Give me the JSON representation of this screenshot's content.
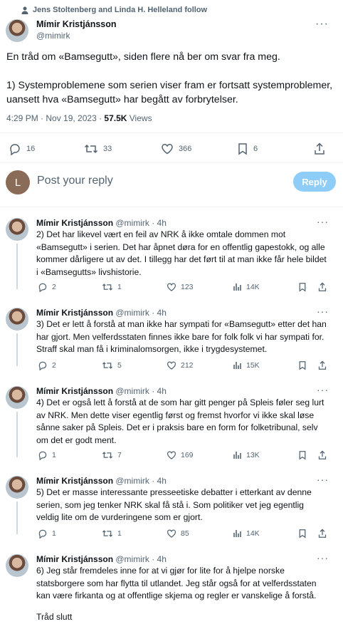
{
  "social_context": "Jens Stoltenberg and Linda H. Helleland follow",
  "main_tweet": {
    "author_name": "Mímir Kristjánsson",
    "author_handle": "@mimirk",
    "text": "En tråd om «Bamsegutt», siden flere nå ber om svar fra meg.\n\n1) Systemproblemene som serien viser fram er fortsatt systemproblemer, uansett hva «Bamsegutt» har begått av forbrytelser.",
    "timestamp": "4:29 PM · Nov 19, 2023 · ",
    "views_count": "57.5K",
    "views_label": " Views",
    "replies": "16",
    "retweets": "33",
    "likes": "366",
    "bookmarks": "6"
  },
  "reply_box": {
    "avatar_letter": "L",
    "placeholder": "Post your reply",
    "button_label": "Reply"
  },
  "thread": [
    {
      "name": "Mímir Kristjánsson",
      "handle": "@mimirk",
      "time": " · 4h",
      "text": "2) Det har likevel vært en feil av NRK å ikke omtale dommen mot «Bamsegutt» i serien. Det har åpnet døra for en offentlig gapestokk, og alle kommer dårligere ut av det. I tillegg har det ført til at man ikke får hele bildet i «Bamsegutts» livshistorie.",
      "replies": "2",
      "retweets": "1",
      "likes": "123",
      "views": "14K"
    },
    {
      "name": "Mímir Kristjánsson",
      "handle": "@mimirk",
      "time": " · 4h",
      "text": "3) Det er lett å forstå at man ikke har sympati for «Bamsegutt» etter det han har gjort. Men velferdsstaten finnes ikke bare for folk folk vi har sympati for. Straff skal man få i kriminalomsorgen, ikke i trygdesystemet.",
      "replies": "2",
      "retweets": "5",
      "likes": "212",
      "views": "15K"
    },
    {
      "name": "Mímir Kristjánsson",
      "handle": "@mimirk",
      "time": " · 4h",
      "text": "4) Det er også lett å forstå at de som har gitt penger på Spleis føler seg lurt av NRK. Men dette viser egentlig først og fremst hvorfor vi ikke skal løse sånne saker på Spleis. Det er i praksis bare en form for folketribunal, selv om det er godt ment.",
      "replies": "1",
      "retweets": "7",
      "likes": "169",
      "views": "13K"
    },
    {
      "name": "Mímir Kristjánsson",
      "handle": "@mimirk",
      "time": " · 4h",
      "text": "5) Det er masse interessante presseetiske debatter i etterkant av denne serien, som jeg tenker NRK skal få stå i. Som politiker vet jeg egentlig veldig lite om de vurderingene som er gjort.",
      "replies": "1",
      "retweets": "1",
      "likes": "85",
      "views": "14K"
    },
    {
      "name": "Mímir Kristjánsson",
      "handle": "@mimirk",
      "time": " · 4h",
      "text": "6) Jeg står fremdeles inne for at vi gjør for lite for å hjelpe norske statsborgere som har flytta til utlandet. Jeg står også for at velferdsstaten kan være firkanta og at offentlige skjema og regler er vanskelige å forstå.",
      "text2": "Tråd slutt",
      "replies": "",
      "retweets": "",
      "likes": "",
      "views": ""
    }
  ],
  "colors": {
    "accent": "#1d9bf0",
    "reply_button": "#8ecdf8",
    "secondary_text": "#536471",
    "divider": "#eff3f4"
  }
}
